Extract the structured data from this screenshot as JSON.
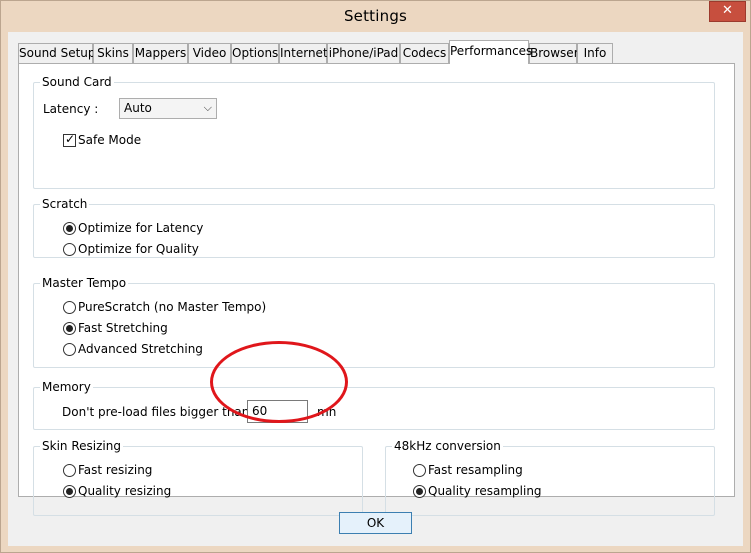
{
  "window": {
    "title": "Settings",
    "close_glyph": "✕"
  },
  "tabs": [
    {
      "label": "Sound Setup"
    },
    {
      "label": "Skins"
    },
    {
      "label": "Mappers"
    },
    {
      "label": "Video"
    },
    {
      "label": "Options"
    },
    {
      "label": "Internet"
    },
    {
      "label": "iPhone/iPad"
    },
    {
      "label": "Codecs"
    },
    {
      "label": "Performances",
      "active": true
    },
    {
      "label": "Browser"
    },
    {
      "label": "Info"
    }
  ],
  "sound_card": {
    "title": "Sound Card",
    "latency_label": "Latency :",
    "latency_value": "Auto",
    "safe_mode_label": "Safe Mode",
    "safe_mode_checked": true
  },
  "scratch": {
    "title": "Scratch",
    "options": [
      {
        "label": "Optimize for Latency",
        "selected": true
      },
      {
        "label": "Optimize for Quality",
        "selected": false
      }
    ]
  },
  "master_tempo": {
    "title": "Master Tempo",
    "options": [
      {
        "label": "PureScratch (no Master Tempo)",
        "selected": false
      },
      {
        "label": "Fast Stretching",
        "selected": true
      },
      {
        "label": "Advanced Stretching",
        "selected": false
      }
    ]
  },
  "memory": {
    "title": "Memory",
    "preload_label": "Don't pre-load files bigger than :",
    "preload_value": "60",
    "unit": "mn"
  },
  "skin_resizing": {
    "title": "Skin Resizing",
    "options": [
      {
        "label": "Fast resizing",
        "selected": false
      },
      {
        "label": "Quality resizing",
        "selected": true
      }
    ]
  },
  "conversion_48khz": {
    "title": "48kHz conversion",
    "options": [
      {
        "label": "Fast resampling",
        "selected": false
      },
      {
        "label": "Quality resampling",
        "selected": true
      }
    ]
  },
  "footer": {
    "ok_label": "OK"
  },
  "colors": {
    "annotation": "#e0161b",
    "frame": "#ecd7c1",
    "close": "#c74f3e"
  }
}
